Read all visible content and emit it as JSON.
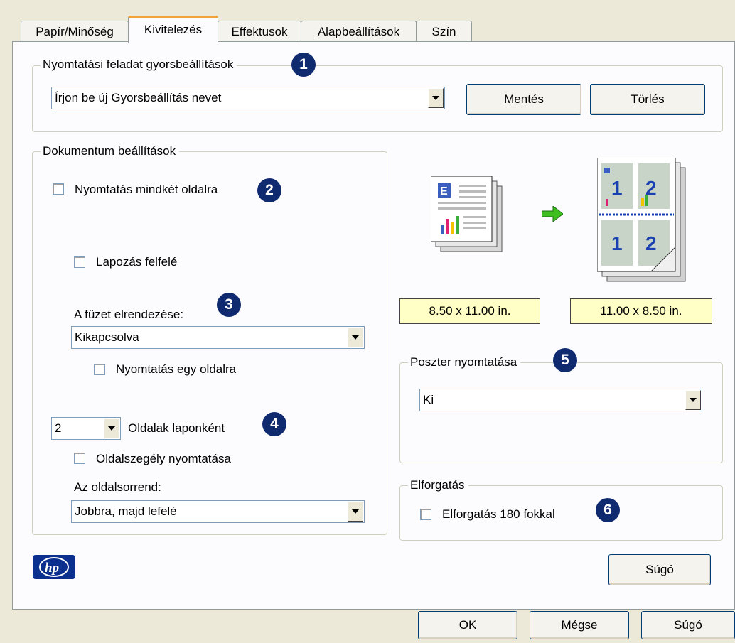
{
  "tabs": [
    "Papír/Minőség",
    "Kivitelezés",
    "Effektusok",
    "Alapbeállítások",
    "Szín"
  ],
  "quick_sets": {
    "legend": "Nyomtatási feladat gyorsbeállítások",
    "badge": "1",
    "combo_value": "Írjon be új Gyorsbeállítás nevet",
    "save_button": "Mentés",
    "delete_button": "Törlés"
  },
  "document": {
    "legend": "Dokumentum beállítások",
    "duplex_label": "Nyomtatás mindkét oldalra",
    "duplex_checked": false,
    "badge2": "2",
    "flip_up_label": "Lapozás felfelé",
    "flip_up_checked": false,
    "booklet_label": "A füzet elrendezése:",
    "badge3": "3",
    "booklet_value": "Kikapcsolva",
    "one_side_label": "Nyomtatás egy oldalra",
    "one_side_checked": false,
    "pages_per_sheet_value": "2",
    "pages_per_sheet_label": "Oldalak laponként",
    "badge4": "4",
    "border_label": "Oldalszegély nyomtatása",
    "border_checked": false,
    "order_label": "Az oldalsorrend:",
    "order_value": "Jobbra, majd lefelé"
  },
  "preview": {
    "source_size": "8.50 x 11.00 in.",
    "target_size": "11.00 x 8.50 in."
  },
  "poster": {
    "legend": "Poszter nyomtatása",
    "badge": "5",
    "value": "Ki"
  },
  "rotation": {
    "legend": "Elforgatás",
    "label": "Elforgatás 180 fokkal",
    "checked": false,
    "badge": "6"
  },
  "help_button": "Súgó",
  "footer": {
    "ok": "OK",
    "cancel": "Mégse",
    "help": "Súgó"
  },
  "colors": {
    "badge": "#0f2a6e",
    "size_label_bg": "#ffffc6",
    "tab_accent": "#f3a33d",
    "arrow": "#3fbf1f"
  }
}
